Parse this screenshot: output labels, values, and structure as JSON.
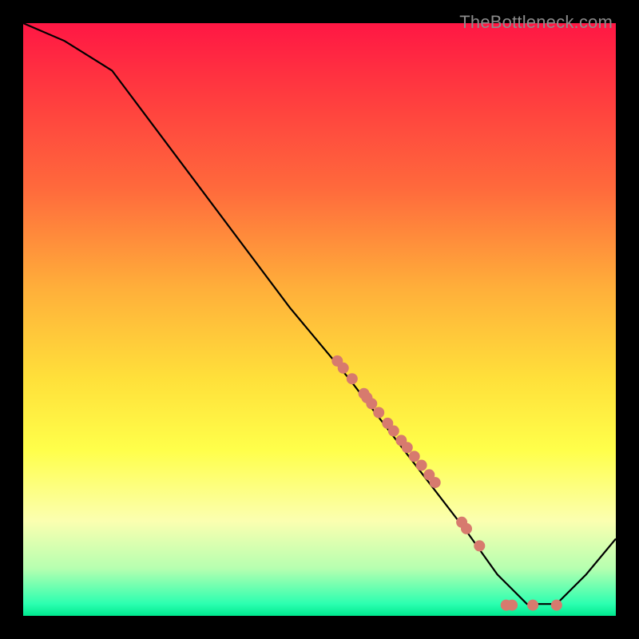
{
  "watermark": "TheBottleneck.com",
  "chart_data": {
    "type": "line",
    "title": "",
    "xlabel": "",
    "ylabel": "",
    "xlim": [
      0,
      1
    ],
    "ylim": [
      0,
      1
    ],
    "series": [
      {
        "name": "curve",
        "x": [
          0.0,
          0.07,
          0.15,
          0.3,
          0.45,
          0.55,
          0.65,
          0.75,
          0.8,
          0.85,
          0.9,
          0.95,
          1.0
        ],
        "y": [
          1.0,
          0.97,
          0.92,
          0.72,
          0.52,
          0.4,
          0.27,
          0.14,
          0.07,
          0.02,
          0.02,
          0.07,
          0.13
        ]
      }
    ],
    "points": [
      {
        "x": 0.53,
        "y": 0.43
      },
      {
        "x": 0.54,
        "y": 0.418
      },
      {
        "x": 0.555,
        "y": 0.4
      },
      {
        "x": 0.575,
        "y": 0.375
      },
      {
        "x": 0.58,
        "y": 0.368
      },
      {
        "x": 0.588,
        "y": 0.358
      },
      {
        "x": 0.6,
        "y": 0.343
      },
      {
        "x": 0.615,
        "y": 0.325
      },
      {
        "x": 0.625,
        "y": 0.312
      },
      {
        "x": 0.638,
        "y": 0.296
      },
      {
        "x": 0.648,
        "y": 0.284
      },
      {
        "x": 0.66,
        "y": 0.269
      },
      {
        "x": 0.672,
        "y": 0.254
      },
      {
        "x": 0.685,
        "y": 0.238
      },
      {
        "x": 0.695,
        "y": 0.225
      },
      {
        "x": 0.74,
        "y": 0.158
      },
      {
        "x": 0.748,
        "y": 0.147
      },
      {
        "x": 0.77,
        "y": 0.118
      },
      {
        "x": 0.815,
        "y": 0.018
      },
      {
        "x": 0.825,
        "y": 0.018
      },
      {
        "x": 0.86,
        "y": 0.018
      },
      {
        "x": 0.9,
        "y": 0.018
      }
    ]
  }
}
